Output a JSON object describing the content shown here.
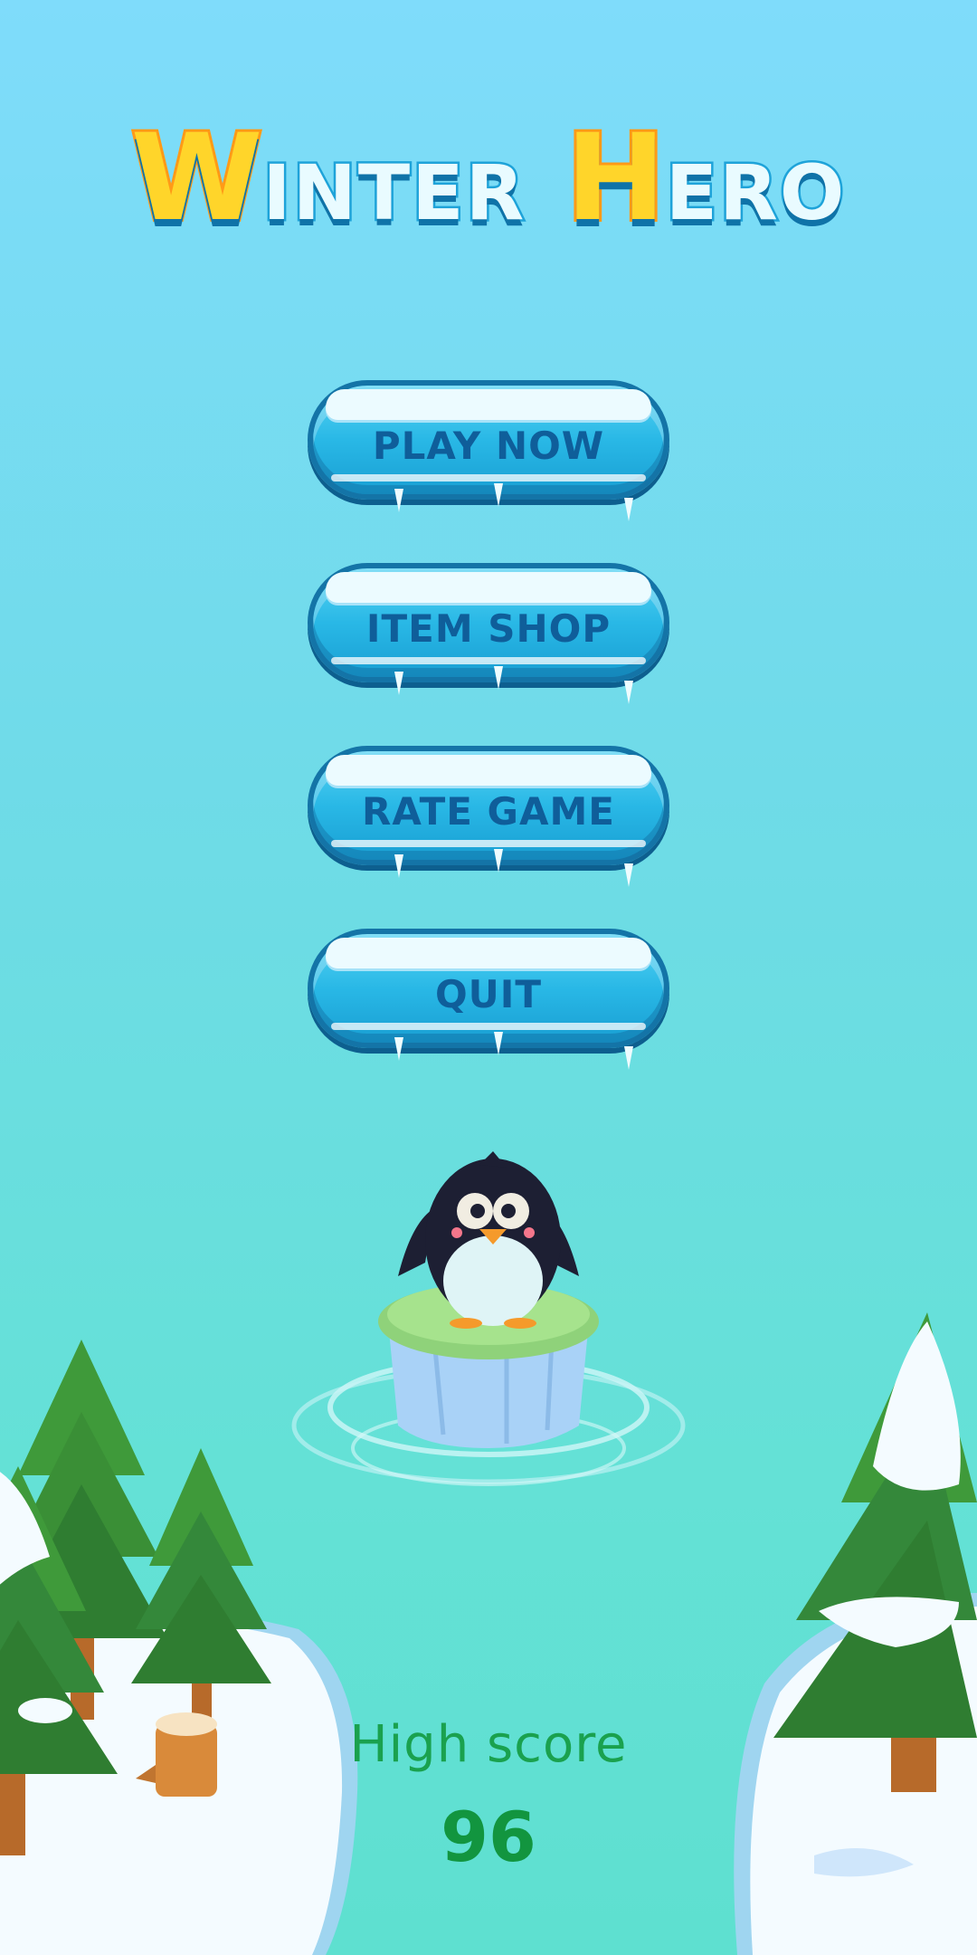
{
  "title": {
    "word1_initial": "W",
    "word1_rest": "INTER",
    "word2_initial": "H",
    "word2_rest": "ERO"
  },
  "menu": {
    "play_label": "PLAY NOW",
    "shop_label": "ITEM SHOP",
    "rate_label": "RATE GAME",
    "quit_label": "QUIT"
  },
  "high_score": {
    "label": "High score",
    "value": "96"
  },
  "colors": {
    "sky_top": "#7fdcfb",
    "sky_bottom": "#5ee0d0",
    "button_fill": "#29b8e6",
    "button_text": "#0f5e9a",
    "title_accent": "#ffd52a",
    "score_green": "#12953f"
  },
  "icons": {
    "mascot": "penguin-icon",
    "decor": [
      "pine-tree-icon",
      "tree-stump-icon",
      "ice-floe-icon",
      "snow-island-icon"
    ]
  }
}
